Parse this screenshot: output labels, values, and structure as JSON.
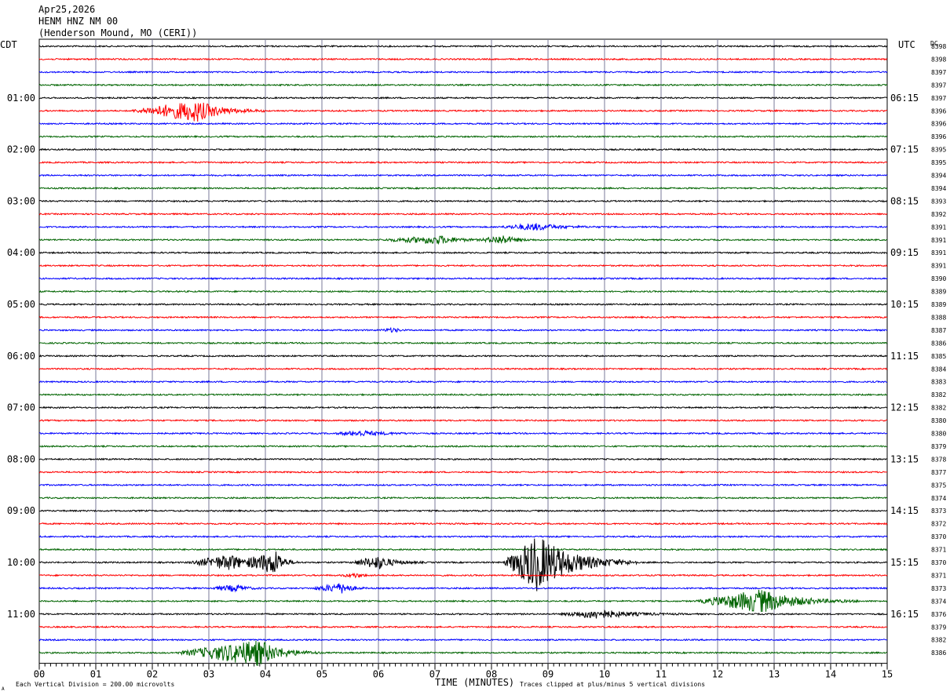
{
  "header": {
    "date": "Apr25,2026",
    "station": "HENM HNZ NM 00",
    "location": "(Henderson Mound, MO (CERI))",
    "left_tz": "CDT",
    "right_tz": "UTC",
    "dc_label": "DC"
  },
  "footer": {
    "xlabel": "TIME (MINUTES)",
    "scale_note": "Each Vertical Division =  200.00 microvolts",
    "clip_note": "Traces clipped at plus/minus 5 vertical divisions",
    "corner_mark": "A"
  },
  "chart_data": {
    "type": "line",
    "title": "HENM HNZ NM 00",
    "xlabel": "TIME (MINUTES)",
    "ylabel": "",
    "xlim": [
      0,
      15
    ],
    "x_ticks": [
      "00",
      "01",
      "02",
      "03",
      "04",
      "05",
      "06",
      "07",
      "08",
      "09",
      "10",
      "11",
      "12",
      "13",
      "14",
      "15"
    ],
    "trace_minutes": 15,
    "trace_count": 48,
    "trace_colors": [
      "#000000",
      "#ff0000",
      "#0000ff",
      "#006400"
    ],
    "grid": true,
    "left_hour_labels": [
      "01:00",
      "02:00",
      "03:00",
      "04:00",
      "05:00",
      "06:00",
      "07:00",
      "08:00",
      "09:00",
      "10:00",
      "11:00"
    ],
    "left_hour_label_rows": [
      4,
      8,
      12,
      16,
      20,
      24,
      28,
      32,
      36,
      40,
      44
    ],
    "right_hour_labels": [
      "06:15",
      "07:15",
      "08:15",
      "09:15",
      "10:15",
      "11:15",
      "12:15",
      "13:15",
      "14:15",
      "15:15",
      "16:15"
    ],
    "right_hour_label_rows": [
      4,
      8,
      12,
      16,
      20,
      24,
      28,
      32,
      36,
      40,
      44
    ],
    "dc_values": [
      "8398",
      "8398",
      "8397",
      "8397",
      "8397",
      "8396",
      "8396",
      "8396",
      "8395",
      "8395",
      "8394",
      "8394",
      "8393",
      "8392",
      "8391",
      "8391",
      "8391",
      "8391",
      "8390",
      "8389",
      "8389",
      "8388",
      "8387",
      "8386",
      "8385",
      "8384",
      "8383",
      "8382",
      "8382",
      "8380",
      "8380",
      "8379",
      "8378",
      "8377",
      "8375",
      "8374",
      "8373",
      "8372",
      "8370",
      "8371",
      "8370",
      "8371",
      "8373",
      "8374",
      "8376",
      "8379",
      "8382",
      "8386"
    ],
    "events": [
      {
        "trace": 5,
        "start": 1.6,
        "center": 2.8,
        "end": 4.0,
        "amplitude": 0.8
      },
      {
        "trace": 14,
        "start": 8.1,
        "center": 8.8,
        "end": 10.0,
        "amplitude": 0.25
      },
      {
        "trace": 15,
        "start": 6.0,
        "center": 7.1,
        "end": 8.0,
        "amplitude": 0.3
      },
      {
        "trace": 15,
        "start": 7.8,
        "center": 8.2,
        "end": 8.8,
        "amplitude": 0.35
      },
      {
        "trace": 22,
        "start": 6.0,
        "center": 6.3,
        "end": 6.5,
        "amplitude": 0.15
      },
      {
        "trace": 30,
        "start": 5.2,
        "center": 5.7,
        "end": 6.8,
        "amplitude": 0.2
      },
      {
        "trace": 40,
        "start": 2.6,
        "center": 3.4,
        "end": 4.2,
        "amplitude": 0.6
      },
      {
        "trace": 40,
        "start": 3.6,
        "center": 4.2,
        "end": 4.6,
        "amplitude": 0.9
      },
      {
        "trace": 40,
        "start": 5.5,
        "center": 6.0,
        "end": 6.8,
        "amplitude": 0.5
      },
      {
        "trace": 40,
        "start": 8.2,
        "center": 8.8,
        "end": 10.6,
        "amplitude": 2.2
      },
      {
        "trace": 41,
        "start": 5.3,
        "center": 5.6,
        "end": 6.0,
        "amplitude": 0.15
      },
      {
        "trace": 42,
        "start": 3.0,
        "center": 3.5,
        "end": 4.0,
        "amplitude": 0.25
      },
      {
        "trace": 42,
        "start": 4.8,
        "center": 5.4,
        "end": 5.8,
        "amplitude": 0.4
      },
      {
        "trace": 43,
        "start": 11.6,
        "center": 12.8,
        "end": 14.5,
        "amplitude": 0.9
      },
      {
        "trace": 44,
        "start": 9.2,
        "center": 9.9,
        "end": 11.4,
        "amplitude": 0.35
      },
      {
        "trace": 47,
        "start": 2.4,
        "center": 3.9,
        "end": 5.0,
        "amplitude": 1.0
      }
    ]
  }
}
